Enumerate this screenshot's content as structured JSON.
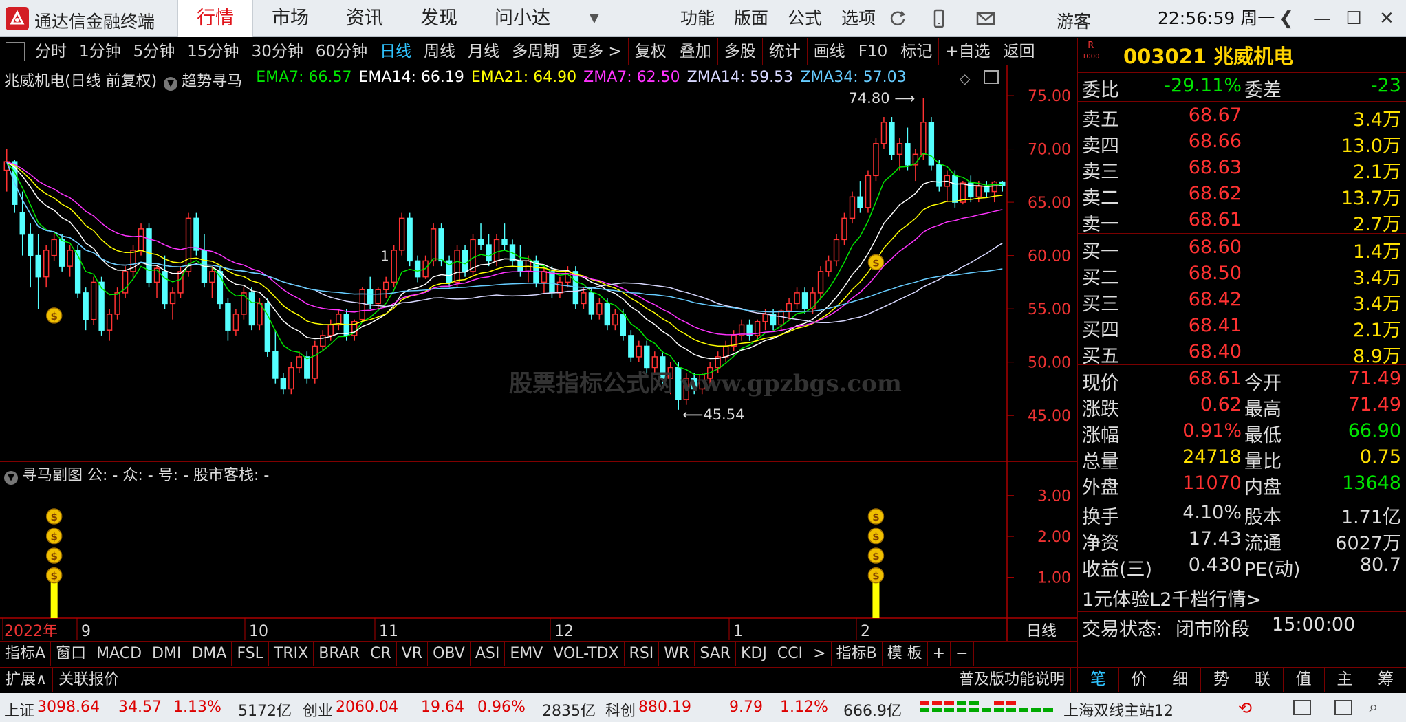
{
  "app": {
    "name": "通达信金融终端",
    "tabs": [
      "行情",
      "市场",
      "资讯",
      "发现",
      "问小达"
    ],
    "active_tab": "行情",
    "menu": [
      "功能",
      "版面",
      "公式",
      "选项"
    ],
    "login": "游客",
    "clock": "22:56:59 周一"
  },
  "toolbar": {
    "items": [
      "分时",
      "1分钟",
      "5分钟",
      "15分钟",
      "30分钟",
      "60分钟",
      "日线",
      "周线",
      "月线",
      "多周期",
      "更多 >",
      "复权",
      "叠加",
      "多股",
      "统计",
      "画线",
      "F10",
      "标记",
      "+自选",
      "返回"
    ],
    "active": "日线"
  },
  "legend": {
    "title": "兆威机电(日线 前复权)",
    "indicator": "趋势寻马",
    "ema7": "EMA7: 66.57",
    "ema14": "EMA14: 66.19",
    "ema21": "EMA21: 64.90",
    "zma7": "ZMA7: 62.50",
    "zma14": "ZMA14: 59.53",
    "zma34": "ZMA34: 57.03",
    "colors": {
      "ema7": "#00e600",
      "ema14": "#ffffff",
      "ema21": "#ffff00",
      "zma7": "#ff33ff",
      "zma14": "#d8d8ff",
      "zma34": "#66ccff"
    }
  },
  "sub": {
    "legend": "寻马副图  公: -  众: -  号: -  股市客栈: -"
  },
  "watermark": "股票指标公式网 www.gpzbgs.com",
  "chart_data": {
    "type": "candlestick",
    "y_ticks": [
      "75.00",
      "70.00",
      "65.00",
      "60.00",
      "55.00",
      "50.00",
      "45.00"
    ],
    "ylim": [
      42.5,
      77
    ],
    "high_label": "74.80",
    "low_label": "45.54",
    "sub_ticks": [
      "3.00",
      "2.00",
      "1.00"
    ],
    "x_labels": [
      "2022年",
      "9",
      "10",
      "11",
      "12",
      "1",
      "2"
    ],
    "period": "日线",
    "candles": [
      [
        68,
        70,
        66,
        68.8
      ],
      [
        68.8,
        69,
        64,
        64.8
      ],
      [
        64,
        66,
        60,
        62
      ],
      [
        62,
        63,
        57,
        60
      ],
      [
        60,
        62,
        55,
        58
      ],
      [
        58,
        61,
        57,
        60.5
      ],
      [
        60,
        62,
        59.5,
        61.5
      ],
      [
        61.5,
        62,
        58.5,
        59
      ],
      [
        59,
        61,
        58,
        60.5
      ],
      [
        60.5,
        61,
        56,
        56.5
      ],
      [
        56.5,
        57,
        53,
        54
      ],
      [
        54,
        58,
        53.5,
        57.5
      ],
      [
        57.5,
        58,
        52.5,
        53
      ],
      [
        53,
        55,
        52,
        54.5
      ],
      [
        54.5,
        57,
        54,
        56.5
      ],
      [
        56.5,
        59,
        56,
        58.5
      ],
      [
        58.5,
        61,
        58,
        60.5
      ],
      [
        60.5,
        63,
        60,
        62.5
      ],
      [
        62.5,
        63,
        57,
        57.5
      ],
      [
        57.5,
        59,
        56,
        58.8
      ],
      [
        58.5,
        60,
        55,
        55.5
      ],
      [
        55.5,
        57,
        54,
        56.5
      ],
      [
        56.5,
        59,
        56,
        58.5
      ],
      [
        58.5,
        64,
        58,
        63.5
      ],
      [
        63.5,
        64,
        60,
        60.5
      ],
      [
        60.5,
        62,
        57,
        57.5
      ],
      [
        57.5,
        59,
        56,
        58.5
      ],
      [
        58.5,
        59,
        55,
        55.5
      ],
      [
        55.5,
        56,
        52,
        53
      ],
      [
        53,
        55,
        52.5,
        54.5
      ],
      [
        54.5,
        57,
        54,
        56.5
      ],
      [
        56.5,
        57,
        53,
        53.5
      ],
      [
        53.5,
        56,
        53,
        55.5
      ],
      [
        55.5,
        56,
        50.5,
        51
      ],
      [
        51,
        53,
        48,
        48.5
      ],
      [
        48.5,
        49,
        47,
        47.5
      ],
      [
        47.5,
        50,
        47,
        49.5
      ],
      [
        49.5,
        51,
        49,
        50.5
      ],
      [
        50.5,
        51,
        48,
        48.5
      ],
      [
        48.5,
        52,
        48,
        51.5
      ],
      [
        51.5,
        53,
        51,
        52.5
      ],
      [
        52.5,
        54,
        52,
        53.5
      ],
      [
        53.5,
        55,
        53,
        54.5
      ],
      [
        54.5,
        55,
        52,
        52.5
      ],
      [
        52.5,
        54,
        52,
        53.8
      ],
      [
        54,
        57,
        53.8,
        56.8
      ],
      [
        56.8,
        58,
        55,
        55.5
      ],
      [
        55.5,
        57,
        55,
        56.8
      ],
      [
        56.8,
        58,
        56,
        57.5
      ],
      [
        57.5,
        61,
        57,
        60.5
      ],
      [
        60.5,
        64,
        60,
        63.5
      ],
      [
        63.5,
        64,
        59,
        59.5
      ],
      [
        59.5,
        60,
        57.5,
        58
      ],
      [
        58,
        60,
        57.8,
        59.5
      ],
      [
        59.5,
        63,
        59,
        62.5
      ],
      [
        62.5,
        63,
        59,
        59.5
      ],
      [
        59.5,
        60,
        57,
        57.5
      ],
      [
        57.5,
        61,
        57,
        60.5
      ],
      [
        60.5,
        61,
        58,
        58.5
      ],
      [
        58.5,
        62,
        58,
        61.5
      ],
      [
        61.5,
        63,
        60.5,
        61
      ],
      [
        61,
        62,
        59,
        59.5
      ],
      [
        59.5,
        62,
        59,
        61.5
      ],
      [
        61.5,
        63,
        60.5,
        61
      ],
      [
        61,
        61.5,
        59,
        59.5
      ],
      [
        59.5,
        61,
        58,
        58.5
      ],
      [
        58.5,
        60,
        57.5,
        59.5
      ],
      [
        59.5,
        60,
        57,
        57.5
      ],
      [
        57.5,
        59,
        56.5,
        58.5
      ],
      [
        58.5,
        59,
        56,
        56.5
      ],
      [
        56.5,
        58,
        56,
        57.5
      ],
      [
        57.5,
        59,
        57,
        58.5
      ],
      [
        58.5,
        59,
        55,
        55.5
      ],
      [
        55.5,
        57,
        55,
        56.5
      ],
      [
        56.5,
        57,
        54,
        54.5
      ],
      [
        54.5,
        56,
        54,
        55.5
      ],
      [
        55.5,
        56,
        53,
        53.5
      ],
      [
        53.5,
        55,
        53,
        54.5
      ],
      [
        54.5,
        55,
        52,
        52.5
      ],
      [
        52.5,
        53,
        50,
        50.5
      ],
      [
        50.5,
        52,
        50,
        51.5
      ],
      [
        51.5,
        52,
        49,
        49.5
      ],
      [
        49.5,
        51,
        49,
        50.5
      ],
      [
        50.5,
        51,
        48,
        48.5
      ],
      [
        48.5,
        50,
        47,
        49.5
      ],
      [
        49.5,
        50,
        45.54,
        46.5
      ],
      [
        46.5,
        49,
        46,
        48.5
      ],
      [
        48.5,
        49,
        47,
        47.5
      ],
      [
        47.5,
        49,
        47,
        48.8
      ],
      [
        48.5,
        50,
        48,
        49.5
      ],
      [
        49.5,
        51,
        49,
        50.5
      ],
      [
        50.5,
        52,
        50,
        51.5
      ],
      [
        51.5,
        53,
        51,
        52.5
      ],
      [
        52.5,
        54,
        52,
        53.5
      ],
      [
        53.5,
        54,
        52,
        52.5
      ],
      [
        52.5,
        54,
        52,
        53.8
      ],
      [
        53.8,
        55,
        53,
        54.5
      ],
      [
        54.5,
        55,
        53,
        53.5
      ],
      [
        53.5,
        55,
        53,
        54.8
      ],
      [
        54.8,
        56,
        54,
        55.5
      ],
      [
        55.5,
        57,
        55,
        56.5
      ],
      [
        56.5,
        57,
        54.5,
        55
      ],
      [
        55,
        57,
        54.5,
        56.5
      ],
      [
        56.5,
        59,
        56,
        58.5
      ],
      [
        58.5,
        60,
        58,
        59.5
      ],
      [
        59.5,
        62,
        59,
        61.5
      ],
      [
        61.5,
        64,
        61,
        63.5
      ],
      [
        63.5,
        66,
        63,
        65.5
      ],
      [
        65.5,
        67,
        64,
        64.5
      ],
      [
        64.5,
        68,
        64,
        67.5
      ],
      [
        67.5,
        71,
        67,
        70.5
      ],
      [
        70.5,
        73,
        70,
        72.5
      ],
      [
        72.5,
        73,
        69,
        69.5
      ],
      [
        69.5,
        71,
        68,
        70.5
      ],
      [
        70.5,
        72,
        68,
        68.5
      ],
      [
        68.5,
        70,
        67,
        69.5
      ],
      [
        69.5,
        74.8,
        69,
        72.5
      ],
      [
        72.5,
        73,
        68,
        68.5
      ],
      [
        68.5,
        69,
        66,
        66.5
      ],
      [
        66.5,
        68,
        65,
        67.5
      ],
      [
        67.5,
        68,
        64.5,
        65
      ],
      [
        65,
        67,
        64.8,
        66.8
      ],
      [
        66.8,
        67.5,
        65,
        65.5
      ],
      [
        65.5,
        67,
        65,
        66.5
      ],
      [
        66.5,
        67,
        65.5,
        66
      ],
      [
        66,
        67,
        65,
        66.9
      ],
      [
        66.9,
        67,
        66,
        66.6
      ]
    ]
  },
  "quote": {
    "code": "003021",
    "name": "兆威机电",
    "rmark": "R",
    "weibi_label": "委比",
    "weibi": "-29.11%",
    "weicha_label": "委差",
    "weicha": "-23",
    "asks": [
      {
        "label": "卖五",
        "price": "68.67",
        "vol": "3.4万"
      },
      {
        "label": "卖四",
        "price": "68.66",
        "vol": "13.0万"
      },
      {
        "label": "卖三",
        "price": "68.63",
        "vol": "2.1万"
      },
      {
        "label": "卖二",
        "price": "68.62",
        "vol": "13.7万"
      },
      {
        "label": "卖一",
        "price": "68.61",
        "vol": "2.7万"
      }
    ],
    "bids": [
      {
        "label": "买一",
        "price": "68.60",
        "vol": "1.4万"
      },
      {
        "label": "买二",
        "price": "68.50",
        "vol": "3.4万"
      },
      {
        "label": "买三",
        "price": "68.42",
        "vol": "3.4万"
      },
      {
        "label": "买四",
        "price": "68.41",
        "vol": "2.1万"
      },
      {
        "label": "买五",
        "price": "68.40",
        "vol": "8.9万"
      }
    ],
    "stats": [
      {
        "l1": "现价",
        "v1": "68.61",
        "c1": "red",
        "l2": "今开",
        "v2": "71.49",
        "c2": "red"
      },
      {
        "l1": "涨跌",
        "v1": "0.62",
        "c1": "red",
        "l2": "最高",
        "v2": "71.49",
        "c2": "red"
      },
      {
        "l1": "涨幅",
        "v1": "0.91%",
        "c1": "red",
        "l2": "最低",
        "v2": "66.90",
        "c2": "green"
      },
      {
        "l1": "总量",
        "v1": "24718",
        "c1": "yellow",
        "l2": "量比",
        "v2": "0.75",
        "c2": "yellow"
      },
      {
        "l1": "外盘",
        "v1": "11070",
        "c1": "red",
        "l2": "内盘",
        "v2": "13648",
        "c2": "green"
      }
    ],
    "fund": [
      {
        "l1": "换手",
        "v1": "4.10%",
        "l2": "股本",
        "v2": "1.71亿"
      },
      {
        "l1": "净资",
        "v1": "17.43",
        "l2": "流通",
        "v2": "6027万"
      },
      {
        "l1": "收益(三)",
        "v1": "0.430",
        "l2": "PE(动)",
        "v2": "80.7"
      }
    ],
    "promo": "1元体验L2千档行情>",
    "trade_label": "交易状态:",
    "trade_state": "闭市阶段",
    "trade_time": "15:00:00"
  },
  "indicators": [
    "指标A",
    "窗口",
    "MACD",
    "DMI",
    "DMA",
    "FSL",
    "TRIX",
    "BRAR",
    "CR",
    "VR",
    "OBV",
    "ASI",
    "EMV",
    "VOL-TDX",
    "RSI",
    "WR",
    "SAR",
    "KDJ",
    "CCI",
    ">",
    "指标B",
    "模 板",
    "+",
    "−"
  ],
  "ext": [
    "扩展∧",
    "关联报价"
  ],
  "help": "普及版功能说明",
  "rtabs": [
    "笔",
    "价",
    "细",
    "势",
    "联",
    "值",
    "主",
    "筹"
  ],
  "rtab_active": "笔",
  "status": {
    "sh_label": "上证",
    "sh": "3098.64",
    "sh_chg": "34.57",
    "sh_pct": "1.13%",
    "sh_amt": "5172亿",
    "cy_label": "创业",
    "cy": "2060.04",
    "cy_chg": "19.64",
    "cy_pct": "0.96%",
    "cy_amt": "2835亿",
    "kc_label": "科创",
    "kc": "880.19",
    "kc_chg": "9.79",
    "kc_pct": "1.12%",
    "kc_amt": "666.9亿",
    "server": "上海双线主站12"
  }
}
